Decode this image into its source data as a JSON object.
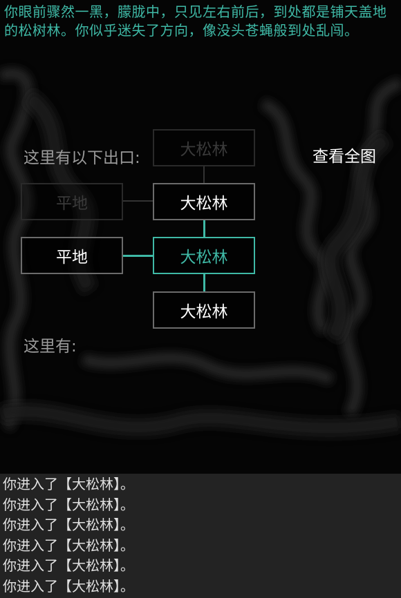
{
  "description": "你眼前骤然一黑，朦胧中，只见左右前后，到处都是铺天盖地的松树林。你似乎迷失了方向，像没头苍蝇般到处乱闯。",
  "exits_label": "这里有以下出口:",
  "map_button": "查看全图",
  "here_label": "这里有:",
  "rooms": {
    "north_far": "大松林",
    "north_west_far": "平地",
    "north": "大松林",
    "west": "平地",
    "current": "大松林",
    "south": "大松林"
  },
  "log": [
    "你进入了【大松林】。",
    "你进入了【大松林】。",
    "你进入了【大松林】。",
    "你进入了【大松林】。",
    "你进入了【大松林】。",
    "你进入了【大松林】。"
  ],
  "colors": {
    "accent": "#3fb9a6",
    "log_bg": "#232323",
    "border": "#6b6b6b"
  }
}
